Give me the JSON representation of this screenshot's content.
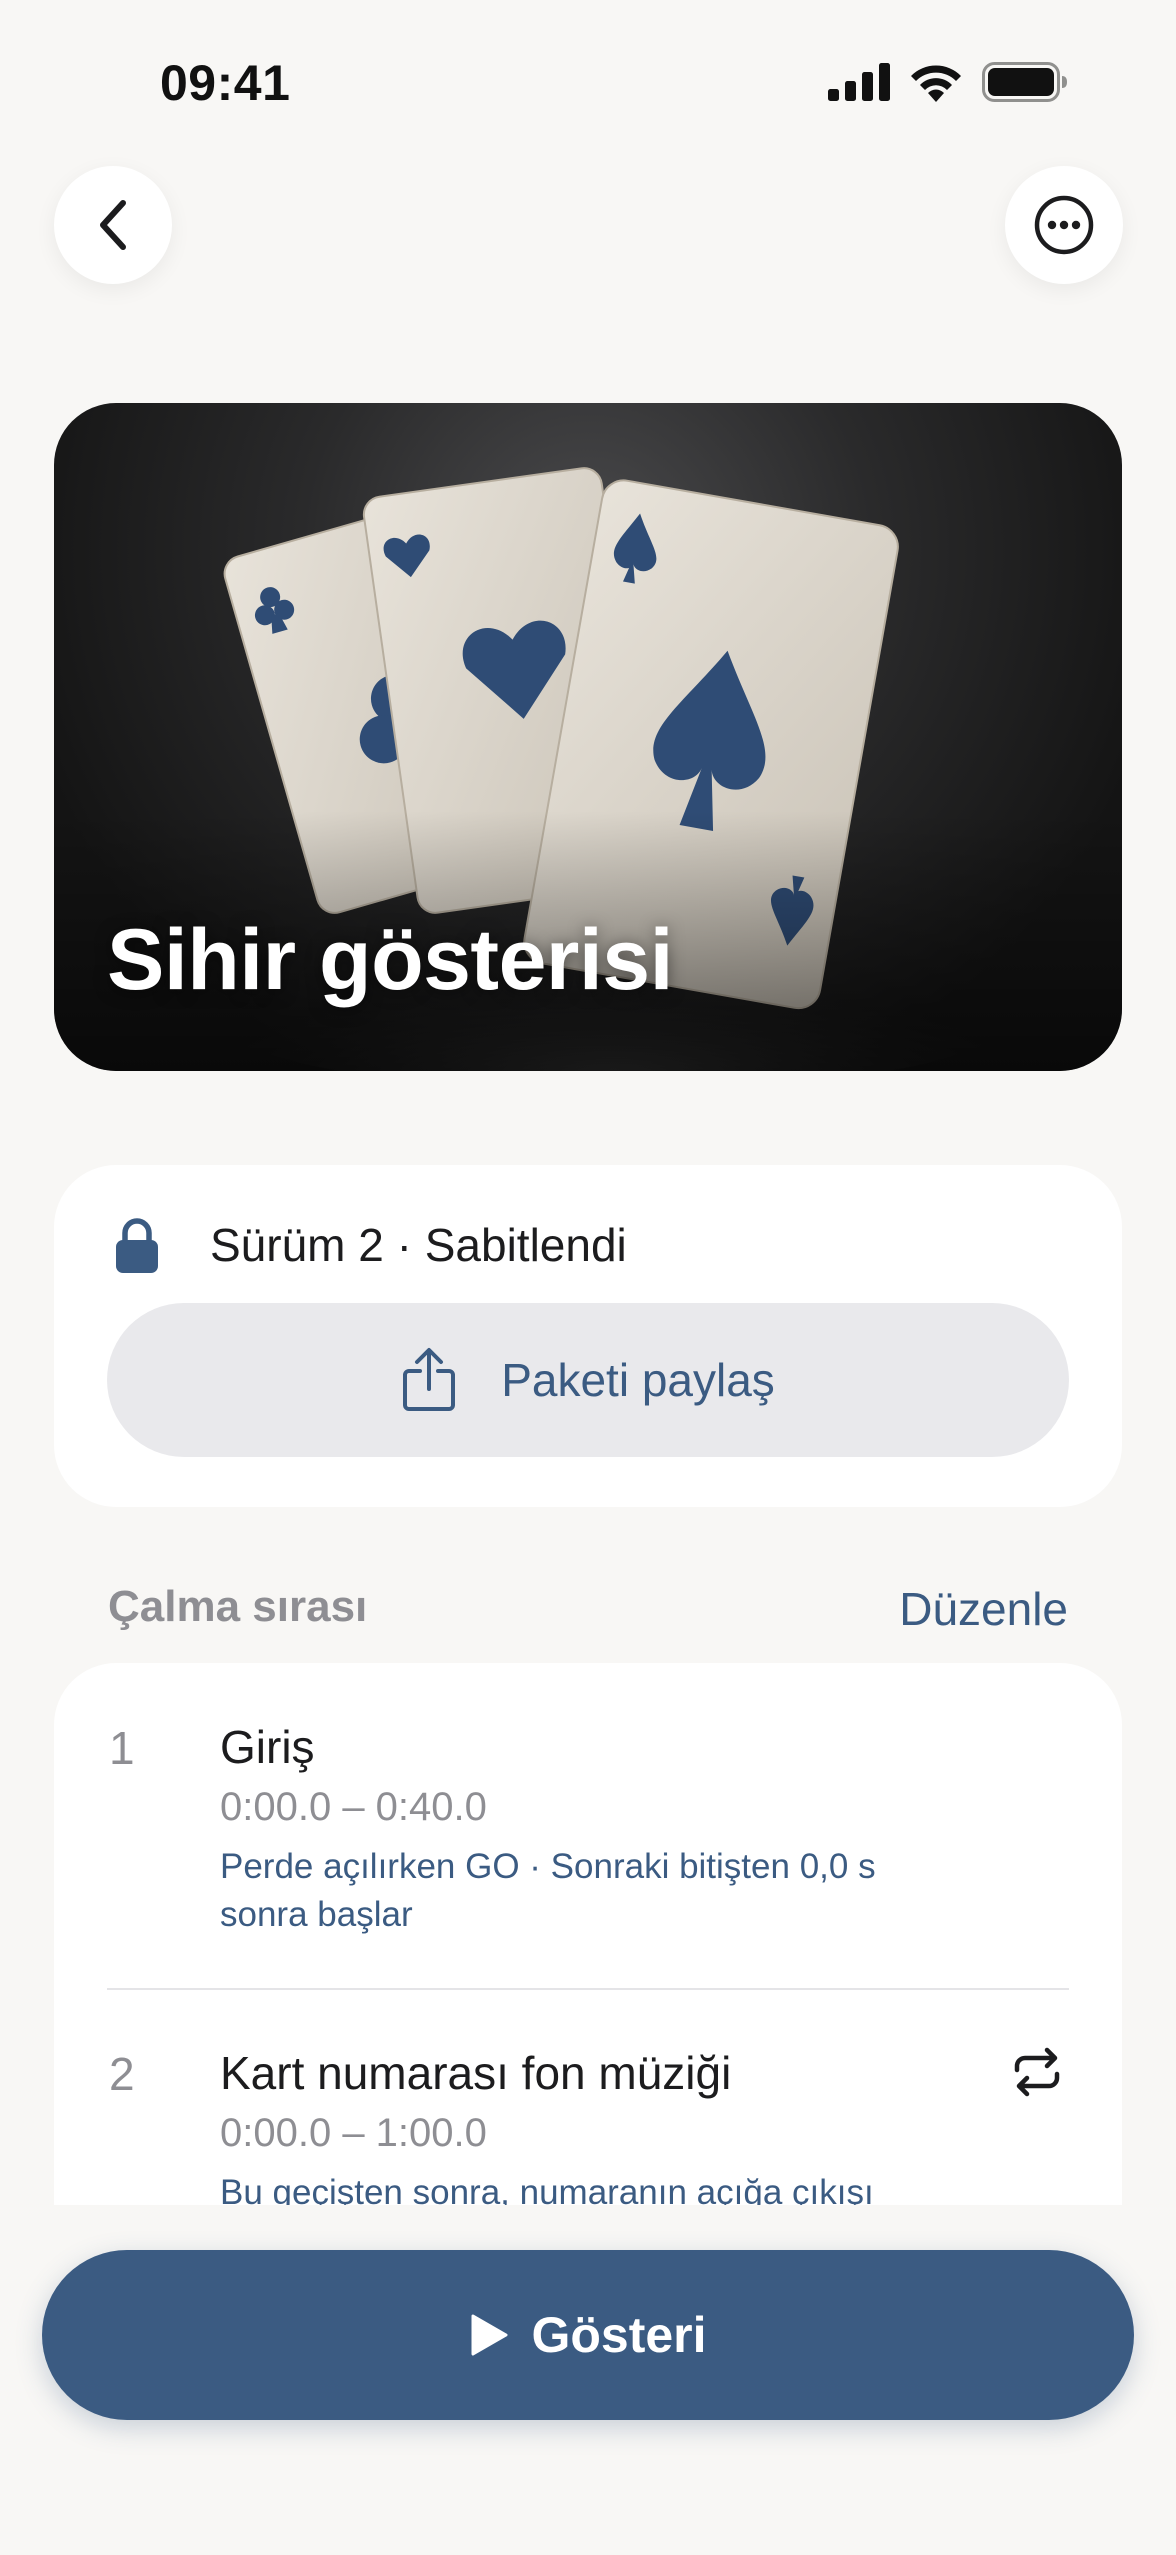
{
  "status_bar": {
    "time": "09:41",
    "icons": [
      "cellular-signal-icon",
      "wifi-icon",
      "battery-icon"
    ]
  },
  "nav": {
    "back_icon": "chevron-left-icon",
    "more_icon": "ellipsis-circle-icon"
  },
  "hero": {
    "title": "Sihir gösterisi",
    "image": "three playing cards (clubs, hearts, spades) on dark background"
  },
  "version": {
    "icon": "lock-icon",
    "text": "Sürüm 2 · Sabitlendi",
    "share_icon": "share-icon",
    "share_label": "Paketi paylaş"
  },
  "playlist": {
    "section_title": "Çalma sırası",
    "edit_label": "Düzenle",
    "cues": [
      {
        "number": "1",
        "title": "Giriş",
        "time": "0:00.0 – 0:40.0",
        "note": "Perde açılırken GO · Sonraki bitişten 0,0 s sonra başlar"
      },
      {
        "number": "2",
        "title": "Kart numarası fon müziği",
        "time": "0:00.0 – 1:00.0",
        "note": "Bu geçişten sonra, numaranın açığa çıkışı",
        "loop_icon": "repeat-icon"
      }
    ]
  },
  "action": {
    "icon": "play-icon",
    "label": "Gösteri"
  },
  "colors": {
    "accent": "#3b5b82",
    "background": "#f8f7f5",
    "card": "#ffffff",
    "secondary_text": "#8e8e93"
  }
}
